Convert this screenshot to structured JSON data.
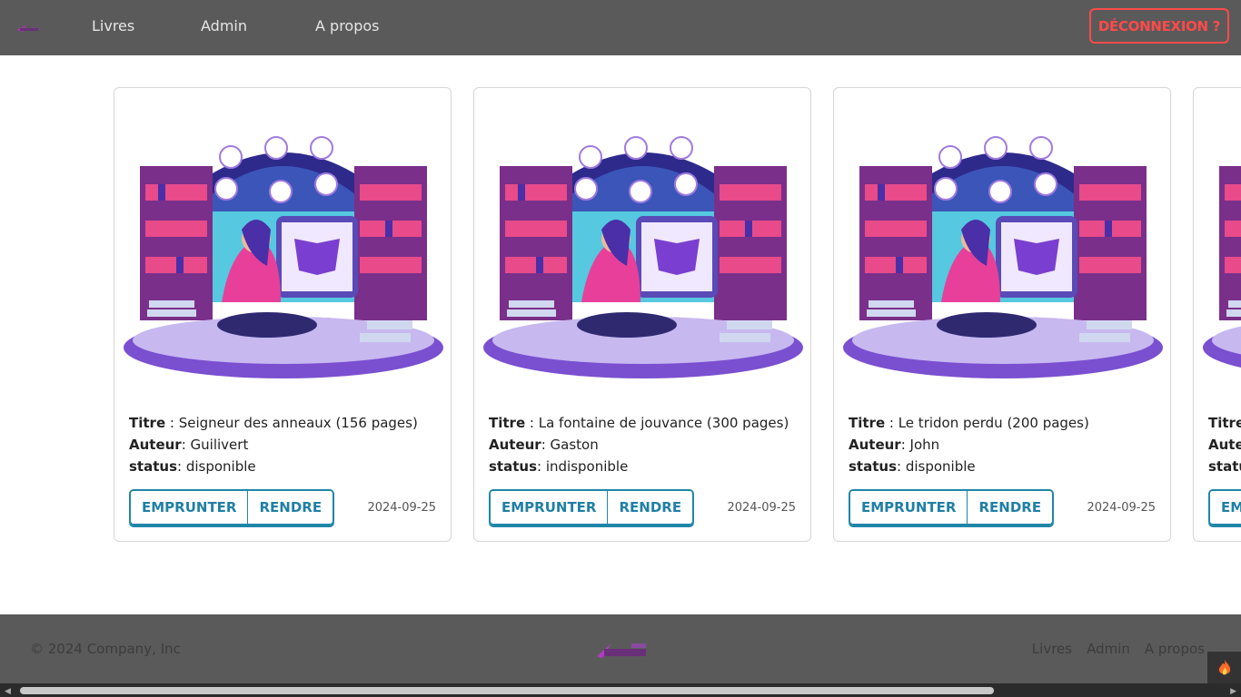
{
  "navbar": {
    "links": [
      "Livres",
      "Admin",
      "A propos"
    ],
    "logout_label": "DÉCONNEXION ?"
  },
  "books": [
    {
      "title": "Seigneur des anneaux (156 pages)",
      "author": "Guilivert",
      "status": "disponible",
      "date": "2024-09-25"
    },
    {
      "title": "La fontaine de jouvance (300 pages)",
      "author": "Gaston",
      "status": "indisponible",
      "date": "2024-09-25"
    },
    {
      "title": "Le tridon perdu (200 pages)",
      "author": "John",
      "status": "disponible",
      "date": "2024-09-25"
    },
    {
      "title": "",
      "author": "",
      "status": "",
      "date": ""
    }
  ],
  "labels": {
    "title": "Titre",
    "author": "Auteur",
    "status": "status",
    "borrow": "EMPRUNTER",
    "return": "RENDRE"
  },
  "footer": {
    "copyright": "© 2024 Company, Inc",
    "links": [
      "Livres",
      "Admin",
      "A propos"
    ]
  },
  "colors": {
    "navbar_bg": "#5a5a5a",
    "logout_accent": "#ff4a4a",
    "button_accent": "#1f86a8"
  }
}
